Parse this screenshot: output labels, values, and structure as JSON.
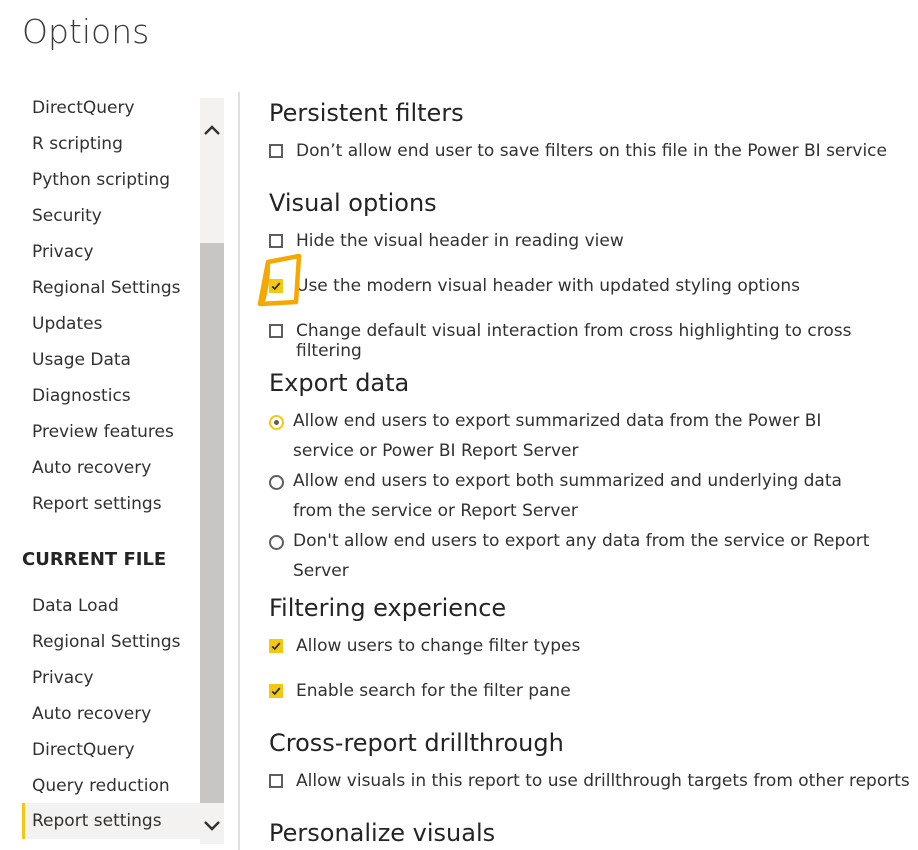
{
  "title": "Options",
  "nav": {
    "global_items": [
      "DirectQuery",
      "R scripting",
      "Python scripting",
      "Security",
      "Privacy",
      "Regional Settings",
      "Updates",
      "Usage Data",
      "Diagnostics",
      "Preview features",
      "Auto recovery",
      "Report settings"
    ],
    "current_file_header": "CURRENT FILE",
    "file_items": [
      "Data Load",
      "Regional Settings",
      "Privacy",
      "Auto recovery",
      "DirectQuery",
      "Query reduction",
      "Report settings"
    ],
    "selected": "Report settings"
  },
  "sections": {
    "persistent_filters": {
      "title": "Persistent filters",
      "options": [
        {
          "label": "Don’t allow end user to save filters on this file in the Power BI service",
          "checked": false
        }
      ]
    },
    "visual_options": {
      "title": "Visual options",
      "options": [
        {
          "label": "Hide the visual header in reading view",
          "checked": false
        },
        {
          "label": "Use the modern visual header with updated styling options",
          "checked": true
        },
        {
          "label": "Change default visual interaction from cross highlighting to cross filtering",
          "checked": false
        }
      ]
    },
    "export_data": {
      "title": "Export data",
      "options": [
        {
          "label": "Allow end users to export summarized data from the Power BI service or Power BI Report Server",
          "selected": true
        },
        {
          "label": "Allow end users to export both summarized and underlying data from the service or Report Server",
          "selected": false
        },
        {
          "label": "Don't allow end users to export any data from the service or Report Server",
          "selected": false
        }
      ]
    },
    "filtering_experience": {
      "title": "Filtering experience",
      "options": [
        {
          "label": "Allow users to change filter types",
          "checked": true
        },
        {
          "label": "Enable search for the filter pane",
          "checked": true
        }
      ]
    },
    "cross_report": {
      "title": "Cross-report drillthrough",
      "options": [
        {
          "label": "Allow visuals in this report to use drillthrough targets from other reports",
          "checked": false
        }
      ]
    },
    "personalize_visuals": {
      "title": "Personalize visuals"
    }
  },
  "colors": {
    "accent": "#f2c811",
    "annotation": "#f5a800"
  }
}
